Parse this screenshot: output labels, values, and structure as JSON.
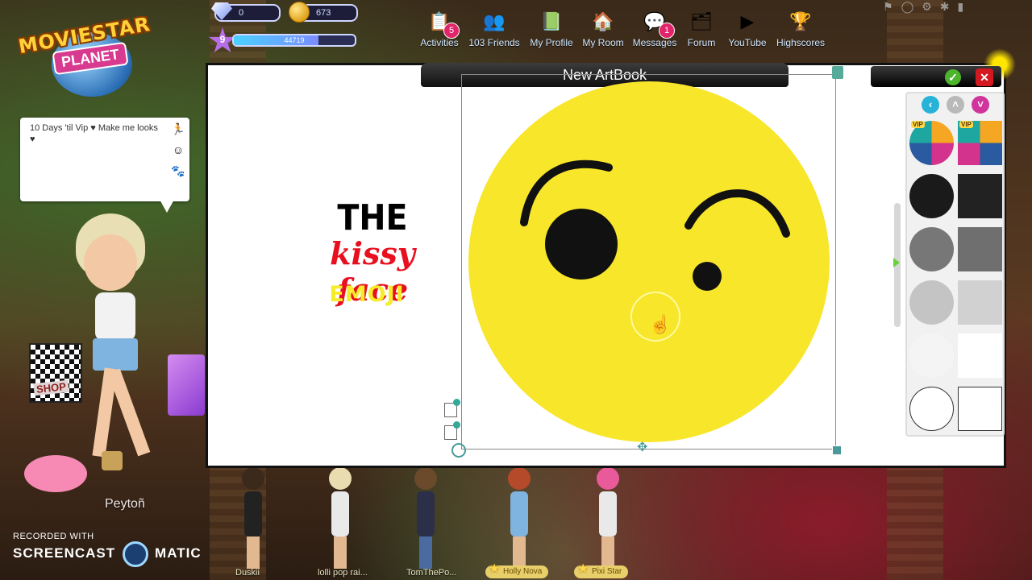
{
  "hud": {
    "logo_line1": "MOVIESTAR",
    "logo_line2": "PLANET",
    "diamonds": "0",
    "coins": "673",
    "level": "9",
    "xp": "44719",
    "xp_fill_fraction": 0.7
  },
  "nav": [
    {
      "label": "Activities",
      "icon": "clipboard-icon",
      "badge": "5"
    },
    {
      "label": "103 Friends",
      "icon": "friends-icon",
      "badge": ""
    },
    {
      "label": "My Profile",
      "icon": "profile-book-icon",
      "badge": ""
    },
    {
      "label": "My Room",
      "icon": "house-icon",
      "badge": ""
    },
    {
      "label": "Messages",
      "icon": "message-bubble-icon",
      "badge": "1"
    },
    {
      "label": "Forum",
      "icon": "forum-icon",
      "badge": ""
    },
    {
      "label": "YouTube",
      "icon": "youtube-icon",
      "badge": ""
    },
    {
      "label": "Highscores",
      "icon": "trophy-icon",
      "badge": ""
    }
  ],
  "chat_bubble": {
    "text": "10 Days 'til Vip ♥ Make me looks ♥"
  },
  "shop_bag_label": "SHOP",
  "player_name": "Peytoñ",
  "artbook": {
    "title": "New ArtBook",
    "headline": {
      "line1": "THE",
      "line2": "kissy face",
      "line3": "EMOJI"
    },
    "palette": {
      "vip_label": "VIP",
      "colors": [
        "#1a1a1a",
        "#222222",
        "#777777",
        "#6f6f6f",
        "#c4c4c4",
        "#d1d1d1",
        "#f4f4f4",
        "#ffffff",
        "#ffffff",
        "#ffffff"
      ],
      "accent_back": "#27b2d8",
      "accent_up": "#b9b9b9",
      "accent_down": "#d0359c"
    },
    "emoji_face_color": "#f8e62b"
  },
  "bottom_characters": [
    {
      "name": "Duskii"
    },
    {
      "name": "lolli pop rai..."
    },
    {
      "name": "TomThePo..."
    },
    {
      "name": "Holly Nova"
    },
    {
      "name": "Pixi Star"
    }
  ],
  "watermark": {
    "line1": "RECORDED WITH",
    "line2a": "SCREENCAST",
    "line2b": "MATIC"
  }
}
